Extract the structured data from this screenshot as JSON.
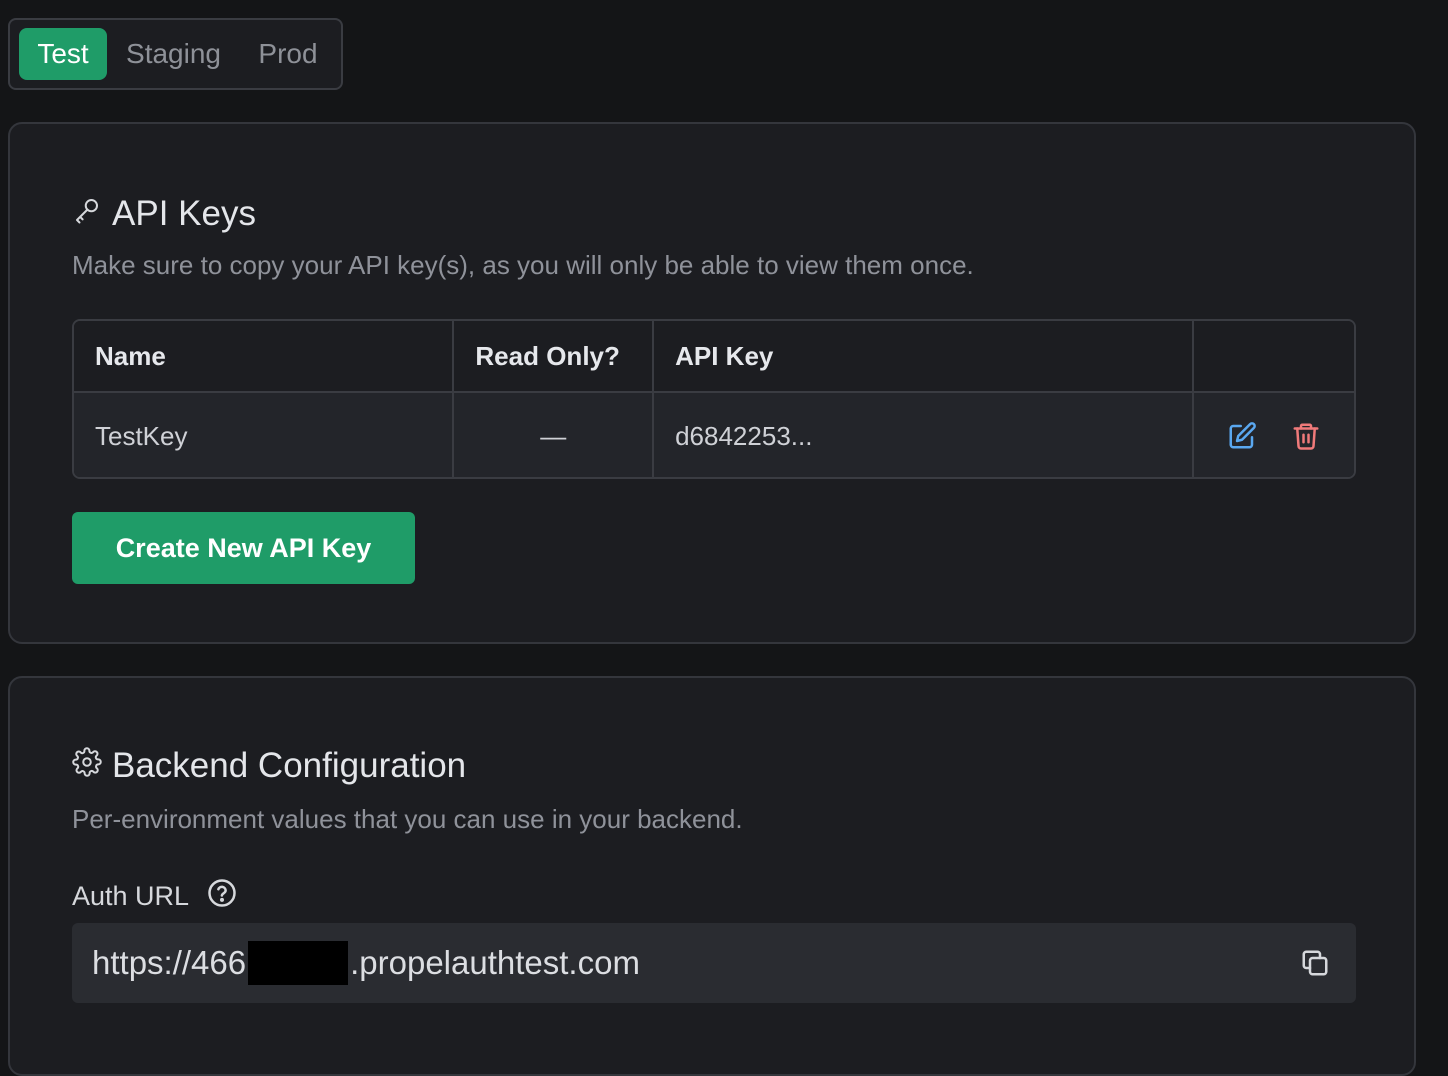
{
  "environments": {
    "tabs": [
      "Test",
      "Staging",
      "Prod"
    ],
    "active": "Test"
  },
  "api_keys": {
    "title": "API Keys",
    "subtitle": "Make sure to copy your API key(s), as you will only be able to view them once.",
    "columns": [
      "Name",
      "Read Only?",
      "API Key",
      ""
    ],
    "rows": [
      {
        "name": "TestKey",
        "read_only": "—",
        "api_key": "d6842253..."
      }
    ],
    "create_button": "Create New API Key"
  },
  "backend": {
    "title": "Backend Configuration",
    "subtitle": "Per-environment values that you can use in your backend.",
    "auth_url_label": "Auth URL",
    "auth_url_prefix": "https://466",
    "auth_url_suffix": ".propelauthtest.com"
  },
  "icons": {
    "api_keys": "key-icon",
    "backend": "gear-icon",
    "help": "help-circle-icon",
    "edit": "edit-icon",
    "delete": "trash-icon",
    "copy": "copy-icon"
  },
  "colors": {
    "accent": "#1f9c68",
    "edit_icon": "#5aa8f0",
    "delete_icon": "#f07a7a"
  }
}
